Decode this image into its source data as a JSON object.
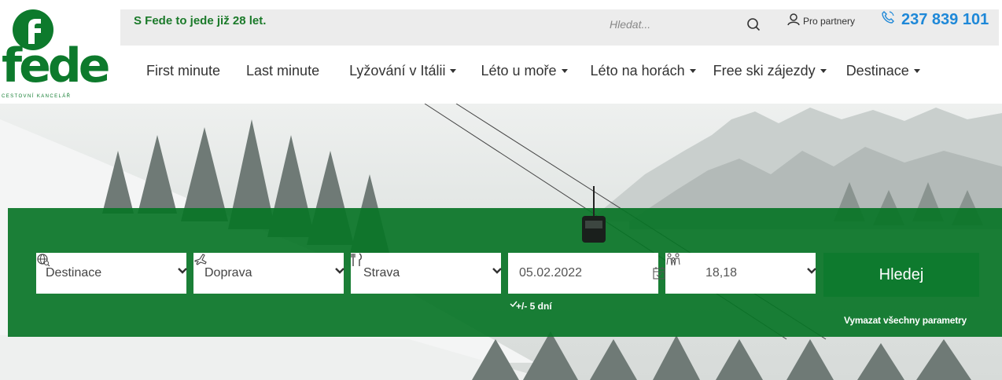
{
  "header": {
    "slogan": "S Fede to jede již 28 let.",
    "search_placeholder": "Hledat...",
    "partners_label": "Pro partnery",
    "phone": "237 839 101"
  },
  "logo": {
    "text": "fede",
    "subtitle": "CESTOVNÍ KANCELÁŘ",
    "brand_color": "#0d7a2c"
  },
  "nav": {
    "items": [
      {
        "label": "First minute",
        "dropdown": false
      },
      {
        "label": "Last minute",
        "dropdown": false
      },
      {
        "label": "Lyžování v Itálii",
        "dropdown": true
      },
      {
        "label": "Léto u moře",
        "dropdown": true
      },
      {
        "label": "Léto na horách",
        "dropdown": true
      },
      {
        "label": "Free ski zájezdy",
        "dropdown": true
      },
      {
        "label": "Destinace",
        "dropdown": true
      }
    ]
  },
  "search_form": {
    "destination": {
      "label": "Destinace",
      "icon": "globe-search-icon"
    },
    "transport": {
      "label": "Doprava",
      "icon": "plane-icon"
    },
    "board": {
      "label": "Strava",
      "icon": "cutlery-icon"
    },
    "date": {
      "value": "05.02.2022",
      "icon": "calendar-icon"
    },
    "persons": {
      "value": "18,18",
      "icon": "family-icon"
    },
    "submit_label": "Hledej",
    "flex_days": "+/- 5 dní",
    "clear_label": "Vymazat všechny parametry",
    "accent_color": "#0e7a2e"
  }
}
